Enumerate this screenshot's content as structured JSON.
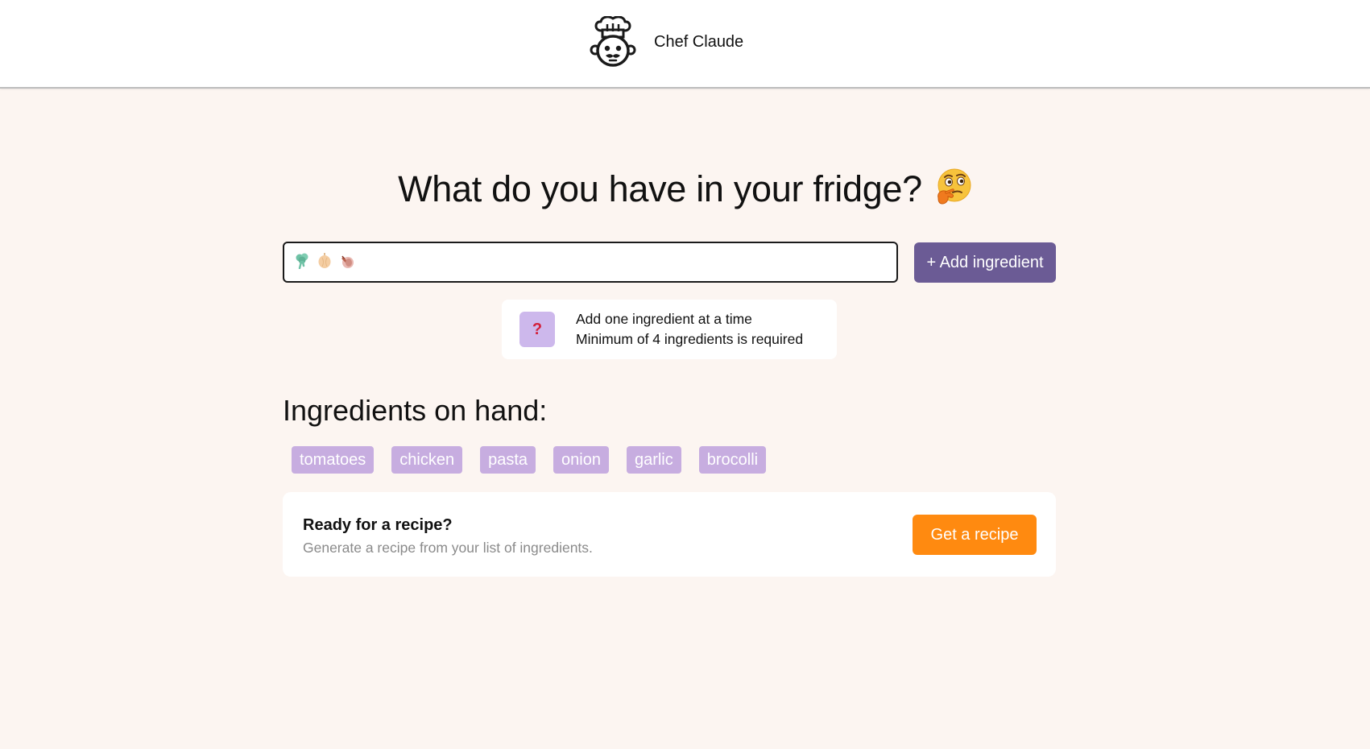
{
  "header": {
    "brand_name": "Chef Claude",
    "logo_icon": "chef-robot-icon"
  },
  "main": {
    "title": "What do you have in your fridge?",
    "title_emoji": "thinking-face-emoji"
  },
  "input": {
    "placeholder_emojis": [
      "broccoli-emoji",
      "onion-emoji",
      "garlic-emoji"
    ],
    "value": "",
    "add_button_label": "+ Add ingredient"
  },
  "hint": {
    "icon": "question-mark-icon",
    "line1": "Add one ingredient at a time",
    "line2": "Minimum of 4 ingredients is required"
  },
  "ingredients": {
    "heading": "Ingredients on hand:",
    "items": [
      "tomatoes",
      "chicken",
      "pasta",
      "onion",
      "garlic",
      "brocolli"
    ]
  },
  "recipe_card": {
    "title": "Ready for a recipe?",
    "subtitle": "Generate a recipe from your list of ingredients.",
    "button_label": "Get a recipe"
  },
  "colors": {
    "page_background": "#FCF5F1",
    "add_button": "#6B5B95",
    "chip": "#C7ADE0",
    "recipe_button": "#FF8A10",
    "hint_icon_bg": "#CDB8EC",
    "hint_icon_mark": "#D3203A"
  }
}
